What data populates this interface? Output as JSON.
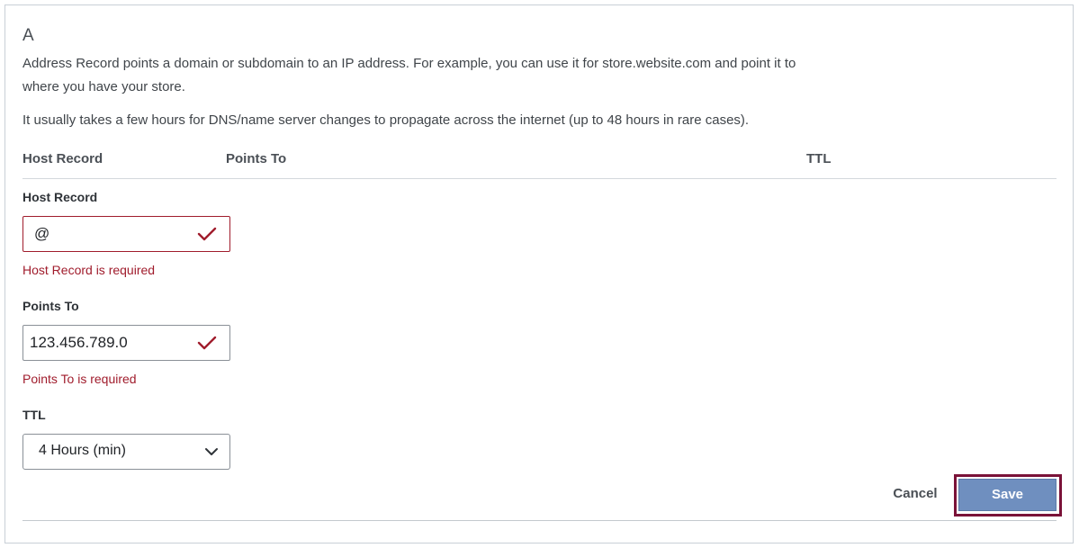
{
  "record": {
    "type_title": "A",
    "description": "Address Record points a domain or subdomain to an IP address. For example, you can use it for store.website.com and point it to where you have your store.",
    "propagation_note": "It usually takes a few hours for DNS/name server changes to propagate across the internet (up to 48 hours in rare cases)."
  },
  "table_header": {
    "host_record": "Host Record",
    "points_to": "Points To",
    "ttl": "TTL"
  },
  "form": {
    "host_record": {
      "label": "Host Record",
      "value": "@",
      "error": "Host Record is required"
    },
    "points_to": {
      "label": "Points To",
      "value": "123.456.789.0",
      "error": "Points To is required"
    },
    "ttl": {
      "label": "TTL",
      "selected": "4 Hours (min)"
    }
  },
  "actions": {
    "cancel_label": "Cancel",
    "save_label": "Save"
  },
  "icons": {
    "valid": "checkmark-icon",
    "dropdown": "chevron-down-icon"
  },
  "colors": {
    "error": "#a01c2c",
    "save_button": "#6f8fbf",
    "highlight": "#7a1238"
  }
}
